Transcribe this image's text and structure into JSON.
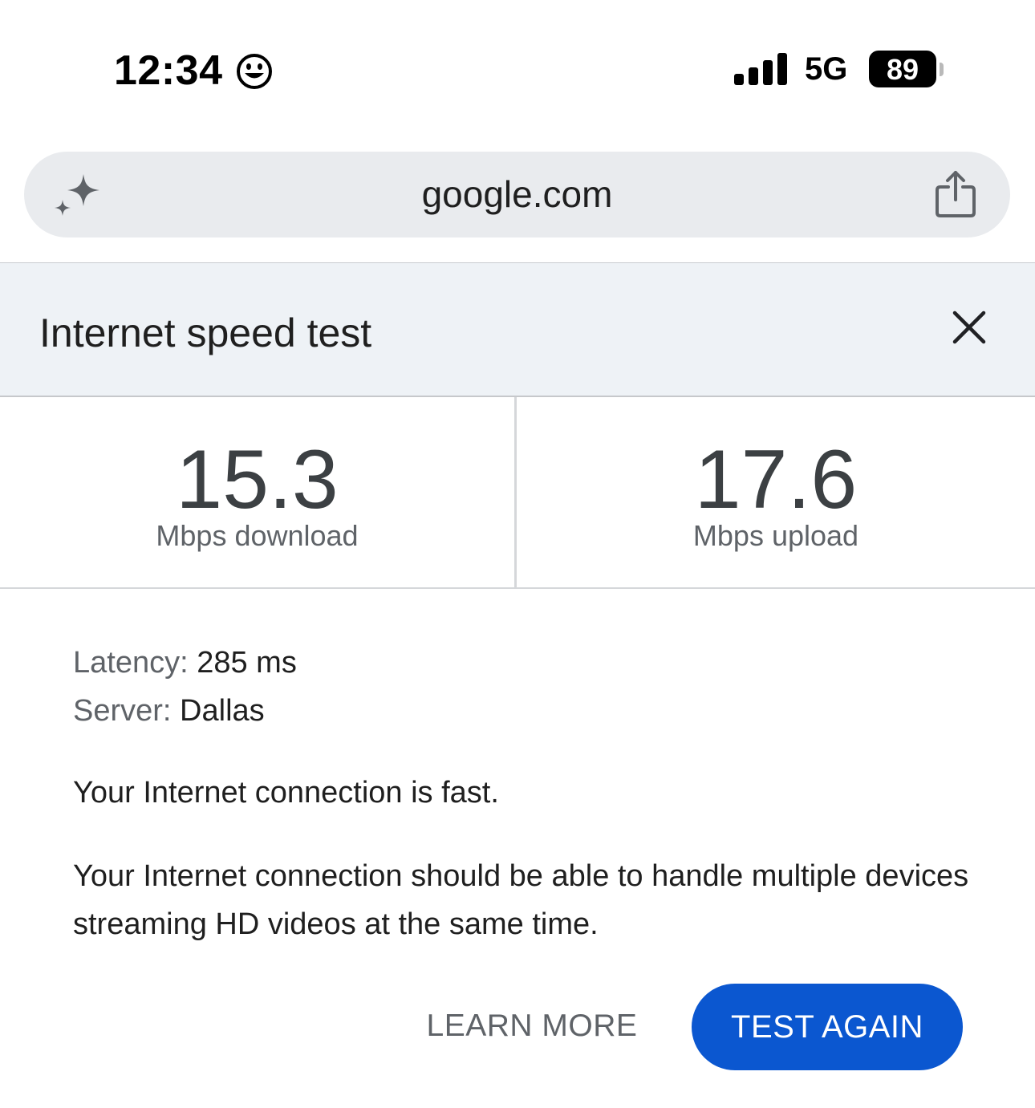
{
  "status_bar": {
    "time": "12:34",
    "network": "5G",
    "battery": "89",
    "icons": [
      "smiley-icon",
      "signal-bars-icon",
      "battery-icon"
    ]
  },
  "address_bar": {
    "url": "google.com",
    "icons": [
      "sparkle-icon",
      "share-icon"
    ]
  },
  "speed_test": {
    "title": "Internet speed test",
    "download": {
      "value": "15.3",
      "unit": "Mbps download"
    },
    "upload": {
      "value": "17.6",
      "unit": "Mbps upload"
    },
    "latency": {
      "label": "Latency:",
      "value": "285 ms"
    },
    "server": {
      "label": "Server:",
      "value": "Dallas"
    },
    "summary": "Your Internet connection is fast.",
    "description": "Your Internet connection should be able to handle multiple devices streaming HD videos at the same time.",
    "learn_more_label": "LEARN MORE",
    "test_again_label": "TEST AGAIN"
  },
  "colors": {
    "accent": "#0b57d0",
    "header_bg": "#eef2f6",
    "address_bg": "#e9ebee"
  }
}
